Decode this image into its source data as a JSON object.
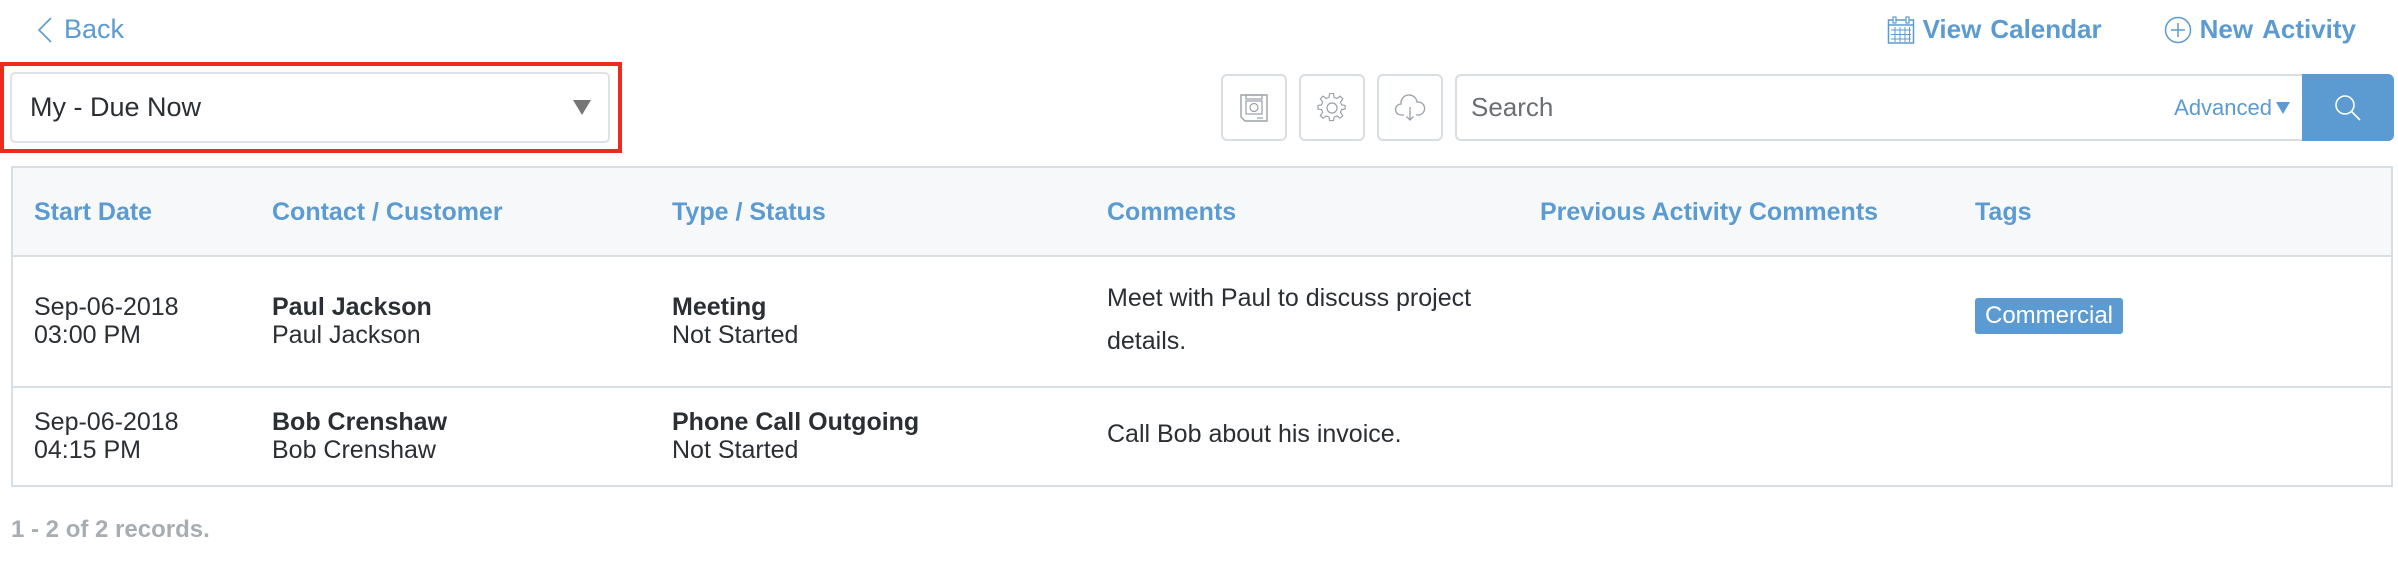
{
  "nav": {
    "back_label": "Back",
    "view_calendar_word1": "View",
    "view_calendar_word2": "Calendar",
    "new_activity_word1": "New",
    "new_activity_word2": "Activity"
  },
  "filter": {
    "selected_view": "My - Due Now",
    "highlight_color": "#ee2a1f"
  },
  "toolbar": {
    "icons": [
      "save-view-icon",
      "settings-icon",
      "cloud-download-icon"
    ],
    "search_placeholder": "Search",
    "search_value": "",
    "advanced_label": "Advanced",
    "accent_color": "#5b9bd1"
  },
  "table": {
    "columns": [
      "Start Date",
      "Contact / Customer",
      "Type / Status",
      "Comments",
      "Previous Activity Comments",
      "Tags"
    ],
    "rows": [
      {
        "date": "Sep-06-2018",
        "time": "03:00 PM",
        "contact": "Paul Jackson",
        "customer": "Paul Jackson",
        "type": "Meeting",
        "status": "Not Started",
        "comments": "Meet with Paul to discuss project details.",
        "previous_comments": "",
        "tags": [
          "Commercial"
        ]
      },
      {
        "date": "Sep-06-2018",
        "time": "04:15 PM",
        "contact": "Bob Crenshaw",
        "customer": "Bob Crenshaw",
        "type": "Phone Call Outgoing",
        "status": "Not Started",
        "comments": "Call Bob about his invoice.",
        "previous_comments": "",
        "tags": []
      }
    ]
  },
  "footer": {
    "record_count": "1 - 2 of 2 records."
  }
}
